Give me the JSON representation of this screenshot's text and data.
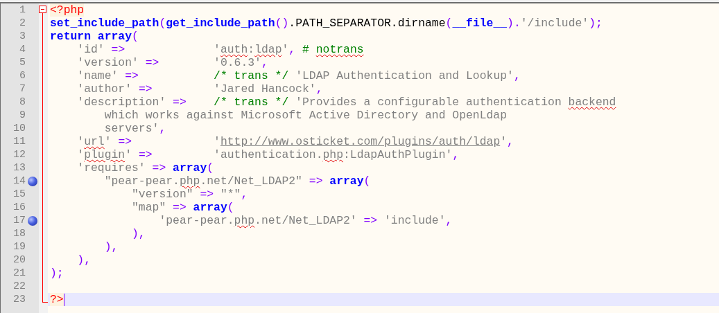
{
  "editor": {
    "lines": [
      {
        "number": "1",
        "bookmark": false,
        "current": false,
        "kind": "fold-start",
        "tokens": [
          {
            "kind": "php-tag",
            "text": "<?php"
          }
        ]
      },
      {
        "number": "2",
        "bookmark": false,
        "current": false,
        "kind": "fold-body",
        "tokens": [
          {
            "kind": "keyword",
            "text": "set_include_path"
          },
          {
            "kind": "operator",
            "text": "("
          },
          {
            "kind": "keyword",
            "text": "get_include_path"
          },
          {
            "kind": "operator",
            "text": "()"
          },
          {
            "kind": "plain",
            "text": ".PATH_SEPARATOR.dirname"
          },
          {
            "kind": "operator",
            "text": "("
          },
          {
            "kind": "keyword",
            "text": "__file__"
          },
          {
            "kind": "operator",
            "text": ")."
          },
          {
            "kind": "string",
            "text": "'/include'"
          },
          {
            "kind": "operator",
            "text": ");"
          }
        ]
      },
      {
        "number": "3",
        "bookmark": false,
        "current": false,
        "kind": "fold-body",
        "tokens": [
          {
            "kind": "keyword",
            "text": "return array"
          },
          {
            "kind": "operator",
            "text": "("
          }
        ]
      },
      {
        "number": "4",
        "bookmark": false,
        "current": false,
        "kind": "fold-body",
        "tokens": [
          {
            "kind": "string",
            "text": "    'id'"
          },
          {
            "kind": "operator",
            "text": " =>"
          },
          {
            "kind": "string",
            "text": "             '"
          },
          {
            "kind": "string-flagged",
            "text": "auth"
          },
          {
            "kind": "string",
            "text": ":"
          },
          {
            "kind": "string-flagged",
            "text": "ldap"
          },
          {
            "kind": "string",
            "text": "'"
          },
          {
            "kind": "operator",
            "text": ","
          },
          {
            "kind": "comment",
            "text": " # "
          },
          {
            "kind": "comment-flagged",
            "text": "notrans"
          }
        ]
      },
      {
        "number": "5",
        "bookmark": false,
        "current": false,
        "kind": "fold-body",
        "tokens": [
          {
            "kind": "string",
            "text": "    'version'"
          },
          {
            "kind": "operator",
            "text": " =>"
          },
          {
            "kind": "string",
            "text": "        '0.6.3'"
          },
          {
            "kind": "operator",
            "text": ","
          }
        ]
      },
      {
        "number": "6",
        "bookmark": false,
        "current": false,
        "kind": "fold-body",
        "tokens": [
          {
            "kind": "string",
            "text": "    'name'"
          },
          {
            "kind": "operator",
            "text": " =>"
          },
          {
            "kind": "comment",
            "text": "           /* trans */"
          },
          {
            "kind": "string",
            "text": " 'LDAP Authentication and Lookup'"
          },
          {
            "kind": "operator",
            "text": ","
          }
        ]
      },
      {
        "number": "7",
        "bookmark": false,
        "current": false,
        "kind": "fold-body",
        "tokens": [
          {
            "kind": "string",
            "text": "    'author'"
          },
          {
            "kind": "operator",
            "text": " =>"
          },
          {
            "kind": "string",
            "text": "         'Jared Hancock'"
          },
          {
            "kind": "operator",
            "text": ","
          }
        ]
      },
      {
        "number": "8",
        "bookmark": false,
        "current": false,
        "kind": "fold-body",
        "tokens": [
          {
            "kind": "string",
            "text": "    'description'"
          },
          {
            "kind": "operator",
            "text": " =>"
          },
          {
            "kind": "comment",
            "text": "    /* trans */"
          },
          {
            "kind": "string",
            "text": " 'Provides a configurable authentication "
          },
          {
            "kind": "string-flagged",
            "text": "backend"
          }
        ]
      },
      {
        "number": "9",
        "bookmark": false,
        "current": false,
        "kind": "fold-body",
        "tokens": [
          {
            "kind": "string",
            "text": "        which works against Microsoft Active Directory and OpenLdap"
          }
        ]
      },
      {
        "number": "10",
        "bookmark": false,
        "current": false,
        "kind": "fold-body",
        "tokens": [
          {
            "kind": "string",
            "text": "        servers'"
          },
          {
            "kind": "operator",
            "text": ","
          }
        ]
      },
      {
        "number": "11",
        "bookmark": false,
        "current": false,
        "kind": "fold-body",
        "tokens": [
          {
            "kind": "string",
            "text": "    '"
          },
          {
            "kind": "string-flagged",
            "text": "url"
          },
          {
            "kind": "string",
            "text": "'"
          },
          {
            "kind": "operator",
            "text": " =>"
          },
          {
            "kind": "string",
            "text": "            '"
          },
          {
            "kind": "string-link",
            "text": "http://www.osticket.com/plugins/auth/ldap"
          },
          {
            "kind": "string",
            "text": "'"
          },
          {
            "kind": "operator",
            "text": ","
          }
        ]
      },
      {
        "number": "12",
        "bookmark": false,
        "current": false,
        "kind": "fold-body",
        "tokens": [
          {
            "kind": "string",
            "text": "    '"
          },
          {
            "kind": "string-flagged",
            "text": "plugin"
          },
          {
            "kind": "string",
            "text": "'"
          },
          {
            "kind": "operator",
            "text": " =>"
          },
          {
            "kind": "string",
            "text": "         'authentication."
          },
          {
            "kind": "string-flagged",
            "text": "php"
          },
          {
            "kind": "string",
            "text": ":LdapAuthPlugin'"
          },
          {
            "kind": "operator",
            "text": ","
          }
        ]
      },
      {
        "number": "13",
        "bookmark": false,
        "current": false,
        "kind": "fold-body",
        "tokens": [
          {
            "kind": "string",
            "text": "    'requires'"
          },
          {
            "kind": "operator",
            "text": " =>"
          },
          {
            "kind": "keyword",
            "text": " array"
          },
          {
            "kind": "operator",
            "text": "("
          }
        ]
      },
      {
        "number": "14",
        "bookmark": true,
        "current": false,
        "kind": "fold-body",
        "tokens": [
          {
            "kind": "string",
            "text": "        \"pear-pear."
          },
          {
            "kind": "string-flagged",
            "text": "php"
          },
          {
            "kind": "string",
            "text": ".net/Net_LDAP2\""
          },
          {
            "kind": "operator",
            "text": " =>"
          },
          {
            "kind": "keyword",
            "text": " array"
          },
          {
            "kind": "operator",
            "text": "("
          }
        ]
      },
      {
        "number": "15",
        "bookmark": false,
        "current": false,
        "kind": "fold-body",
        "tokens": [
          {
            "kind": "string",
            "text": "            \"version\""
          },
          {
            "kind": "operator",
            "text": " =>"
          },
          {
            "kind": "string",
            "text": " \"*\""
          },
          {
            "kind": "operator",
            "text": ","
          }
        ]
      },
      {
        "number": "16",
        "bookmark": false,
        "current": false,
        "kind": "fold-body",
        "tokens": [
          {
            "kind": "string",
            "text": "            \"map\""
          },
          {
            "kind": "operator",
            "text": " =>"
          },
          {
            "kind": "keyword",
            "text": " array"
          },
          {
            "kind": "operator",
            "text": "("
          }
        ]
      },
      {
        "number": "17",
        "bookmark": true,
        "current": false,
        "kind": "fold-body",
        "tokens": [
          {
            "kind": "string",
            "text": "                'pear-pear."
          },
          {
            "kind": "string-flagged",
            "text": "php"
          },
          {
            "kind": "string",
            "text": ".net/Net_LDAP2'"
          },
          {
            "kind": "operator",
            "text": " =>"
          },
          {
            "kind": "string",
            "text": " 'include'"
          },
          {
            "kind": "operator",
            "text": ","
          }
        ]
      },
      {
        "number": "18",
        "bookmark": false,
        "current": false,
        "kind": "fold-body",
        "tokens": [
          {
            "kind": "operator",
            "text": "            ),"
          }
        ]
      },
      {
        "number": "19",
        "bookmark": false,
        "current": false,
        "kind": "fold-body",
        "tokens": [
          {
            "kind": "operator",
            "text": "        ),"
          }
        ]
      },
      {
        "number": "20",
        "bookmark": false,
        "current": false,
        "kind": "fold-body",
        "tokens": [
          {
            "kind": "operator",
            "text": "    ),"
          }
        ]
      },
      {
        "number": "21",
        "bookmark": false,
        "current": false,
        "kind": "fold-body",
        "tokens": [
          {
            "kind": "operator",
            "text": ");"
          }
        ]
      },
      {
        "number": "22",
        "bookmark": false,
        "current": false,
        "kind": "fold-body"
      },
      {
        "number": "23",
        "bookmark": false,
        "current": true,
        "kind": "fold-end",
        "tokens": [
          {
            "kind": "php-tag",
            "text": "?>"
          }
        ]
      }
    ]
  }
}
